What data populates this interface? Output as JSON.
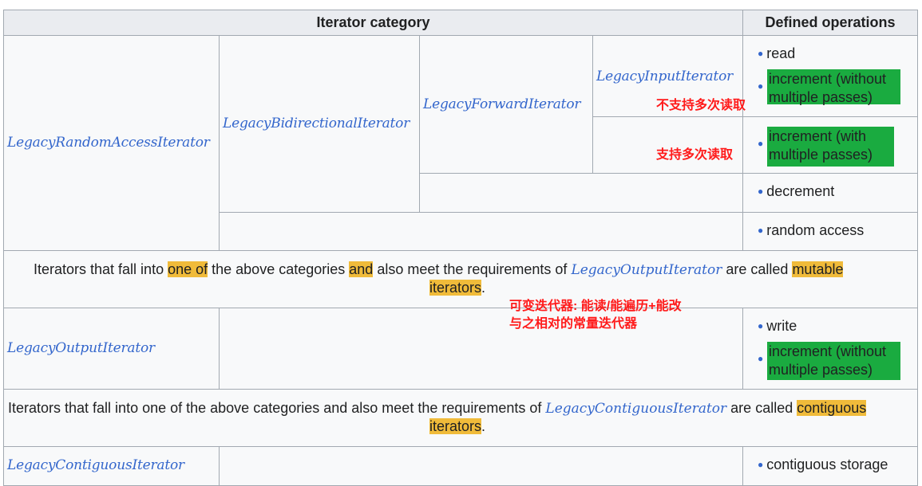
{
  "header": {
    "iterator_category": "Iterator category",
    "defined_operations": "Defined operations"
  },
  "categories": {
    "random_access": "LegacyRandomAccessIterator",
    "bidirectional": "LegacyBidirectionalIterator",
    "forward": "LegacyForwardIterator",
    "input": "LegacyInputIterator",
    "output": "LegacyOutputIterator",
    "contiguous": "LegacyContiguousIterator"
  },
  "operations": {
    "read": "read",
    "increment_no_multi_line1": "increment (without",
    "increment_no_multi_line2": "multiple passes)",
    "increment_multi_line1": "increment (with",
    "increment_multi_line2": "multiple passes)",
    "decrement": "decrement",
    "random_access": "random access",
    "write": "write",
    "out_increment_line1": "increment (without",
    "out_increment_line2": "multiple passes)",
    "contiguous_storage": "contiguous storage"
  },
  "notes": {
    "no_multi_read": "不支持多次读取",
    "multi_read": "支持多次读取",
    "mutable_line1": "可变迭代器: 能读/能遍历+能改",
    "mutable_line2": "与之相对的常量迭代器"
  },
  "mutable_para": {
    "t1": "Iterators that fall into ",
    "t2": "one of",
    "t3": " the above categories ",
    "t4": "and",
    "t5": " also meet the requirements of ",
    "link": "LegacyOutputIterator",
    "t6": " are called ",
    "t7": "mutable ",
    "t8": "iterators",
    "t9": "."
  },
  "contiguous_para": {
    "t1": "Iterators that fall into one of the above categories and also meet the requirements of ",
    "link": "LegacyContiguousIterator",
    "t2": " are called ",
    "t3": "contiguous ",
    "t4": "iterators",
    "t5": "."
  }
}
